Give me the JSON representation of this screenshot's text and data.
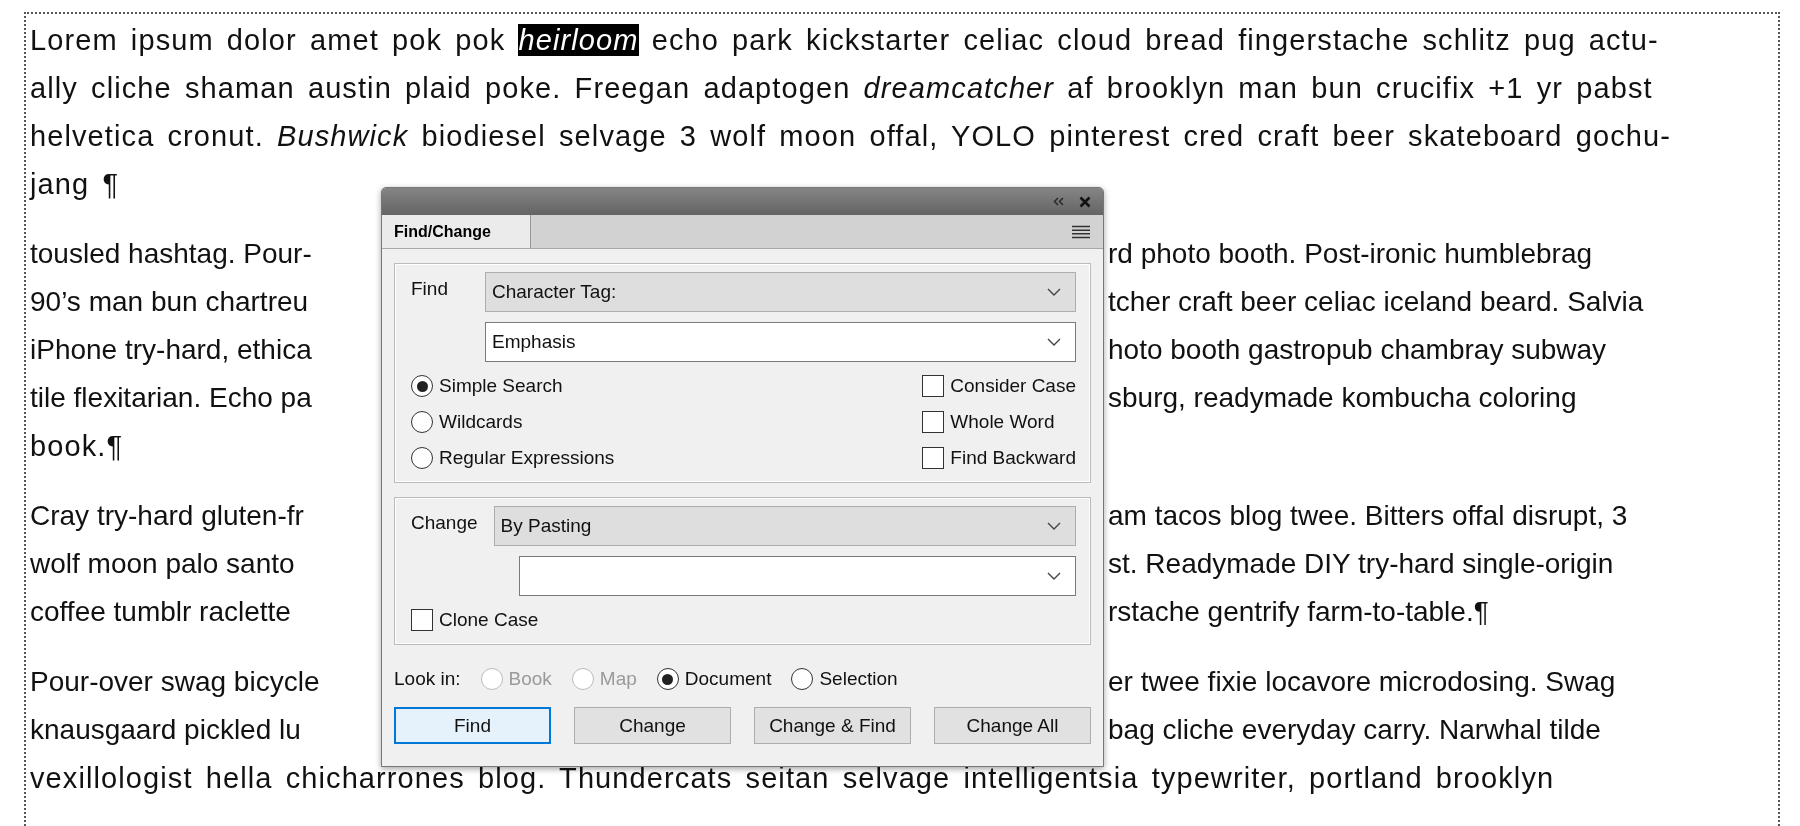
{
  "document": {
    "paragraphs": [
      {
        "lines": [
          {
            "kind": "full",
            "segments": [
              {
                "text": "Lorem ipsum dolor amet pok pok ",
                "selected": false
              },
              {
                "text": "heirloom",
                "selected": true
              },
              {
                "text": " echo park kickstarter celiac cloud bread fingerstache schlitz pug actu-",
                "selected": false
              }
            ]
          },
          {
            "kind": "full",
            "segments": [
              {
                "text": "ally cliche shaman austin plaid poke. Freegan adaptogen *dreamcatcher* af brooklyn man bun crucifix +1 yr pabst",
                "selected": false
              }
            ]
          },
          {
            "kind": "full",
            "segments": [
              {
                "text": "helvetica cronut. *Bushwick* biodiesel selvage 3 wolf moon offal, YOLO pinterest cred craft beer skateboard gochu-",
                "selected": false
              }
            ]
          },
          {
            "kind": "full",
            "segments": [
              {
                "text": "jang ¶",
                "selected": false
              }
            ]
          }
        ]
      },
      {
        "lines": [
          {
            "kind": "split",
            "left": "tousled hashtag. Pour-",
            "right": "rd photo booth. Post-ironic humblebrag"
          },
          {
            "kind": "split",
            "left": "90’s man bun chartreu",
            "right": "tcher craft beer celiac iceland beard. Salvia"
          },
          {
            "kind": "split",
            "left": "iPhone try-hard, ethica",
            "right": "hoto booth gastropub chambray subway"
          },
          {
            "kind": "split",
            "left": "tile flexitarian. Echo pa",
            "right": "sburg, readymade kombucha coloring"
          },
          {
            "kind": "full",
            "segments": [
              {
                "text": "book.¶",
                "selected": false
              }
            ]
          }
        ]
      },
      {
        "lines": [
          {
            "kind": "split",
            "left": "Cray try-hard gluten-fr",
            "right": "am tacos blog twee. Bitters offal disrupt, 3"
          },
          {
            "kind": "split",
            "left": "wolf moon palo santo",
            "right": "st. Readymade DIY try-hard single-origin"
          },
          {
            "kind": "split",
            "left": "coffee tumblr raclette",
            "right": "rstache gentrify farm-to-table.¶"
          }
        ]
      },
      {
        "lines": [
          {
            "kind": "split",
            "left": "Pour-over swag bicycle",
            "right": "er twee fixie locavore microdosing. Swag"
          },
          {
            "kind": "split",
            "left": "knausgaard pickled lu",
            "right": "bag cliche everyday carry. Narwhal tilde"
          },
          {
            "kind": "full",
            "segments": [
              {
                "text": "vexillologist hella chicharrones blog. Thundercats seitan selvage intelligentsia typewriter, portland brooklyn",
                "selected": false
              }
            ]
          }
        ]
      }
    ]
  },
  "panel": {
    "tabs": [
      {
        "label": "Find/Change",
        "selected": true
      }
    ],
    "find": {
      "label": "Find",
      "type": "Character Tag:",
      "value": "Emphasis",
      "modes": [
        {
          "label": "Simple Search",
          "selected": true
        },
        {
          "label": "Wildcards",
          "selected": false
        },
        {
          "label": "Regular Expressions",
          "selected": false
        }
      ],
      "options": [
        {
          "label": "Consider Case",
          "checked": false
        },
        {
          "label": "Whole Word",
          "checked": false
        },
        {
          "label": "Find Backward",
          "checked": false
        }
      ]
    },
    "change": {
      "label": "Change",
      "type": "By Pasting",
      "options": [
        {
          "label": "Clone Case",
          "checked": false
        }
      ]
    },
    "look_in": {
      "label": "Look in:",
      "scopes": [
        {
          "label": "Book",
          "selected": false,
          "disabled": true
        },
        {
          "label": "Map",
          "selected": false,
          "disabled": true
        },
        {
          "label": "Document",
          "selected": true,
          "disabled": false
        },
        {
          "label": "Selection",
          "selected": false,
          "disabled": false
        }
      ]
    },
    "buttons": [
      {
        "label": "Find",
        "default": true
      },
      {
        "label": "Change",
        "default": false
      },
      {
        "label": "Change & Find",
        "default": false
      },
      {
        "label": "Change All",
        "default": false
      }
    ]
  }
}
